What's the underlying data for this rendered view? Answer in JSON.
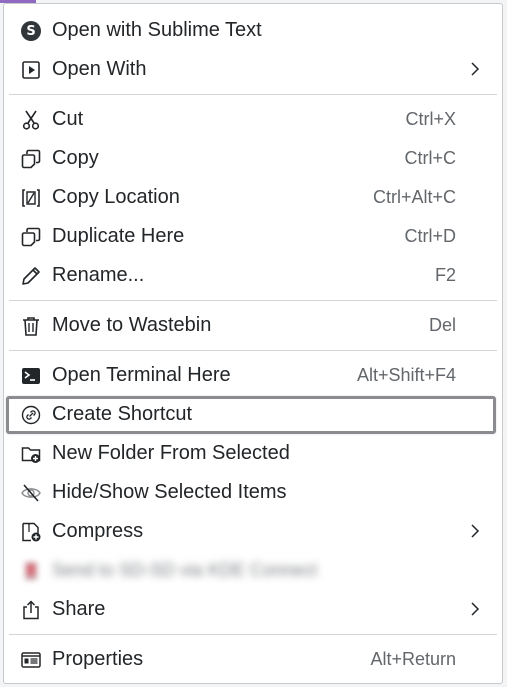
{
  "colors": {
    "text": "#232629",
    "shortcut": "#63676b",
    "separator": "#d3d5d7",
    "highlight_border": "#8a8c8f",
    "accent": "#8e6bc0"
  },
  "menu": {
    "open_sublime": {
      "label": "Open with Sublime Text",
      "icon": "sublime-text-icon"
    },
    "open_with": {
      "label": "Open With",
      "icon": "open-with-icon"
    },
    "cut": {
      "label": "Cut",
      "shortcut": "Ctrl+X",
      "icon": "scissors-icon"
    },
    "copy": {
      "label": "Copy",
      "shortcut": "Ctrl+C",
      "icon": "copy-icon"
    },
    "copy_location": {
      "label": "Copy Location",
      "shortcut": "Ctrl+Alt+C",
      "icon": "copy-location-icon"
    },
    "duplicate": {
      "label": "Duplicate Here",
      "shortcut": "Ctrl+D",
      "icon": "duplicate-icon"
    },
    "rename": {
      "label": "Rename...",
      "shortcut": "F2",
      "icon": "pencil-icon"
    },
    "wastebin": {
      "label": "Move to Wastebin",
      "shortcut": "Del",
      "icon": "trash-icon"
    },
    "terminal": {
      "label": "Open Terminal Here",
      "shortcut": "Alt+Shift+F4",
      "icon": "terminal-icon"
    },
    "shortcut": {
      "label": "Create Shortcut",
      "icon": "link-icon"
    },
    "new_folder": {
      "label": "New Folder From Selected",
      "icon": "folder-add-icon"
    },
    "hide_show": {
      "label": "Hide/Show Selected Items",
      "icon": "eye-off-icon"
    },
    "compress": {
      "label": "Compress",
      "icon": "archive-icon"
    },
    "send_to": {
      "label": "Send to SD-SD via KDE Connect",
      "icon": "device-icon"
    },
    "share": {
      "label": "Share",
      "icon": "share-icon"
    },
    "properties": {
      "label": "Properties",
      "shortcut": "Alt+Return",
      "icon": "properties-icon"
    }
  }
}
